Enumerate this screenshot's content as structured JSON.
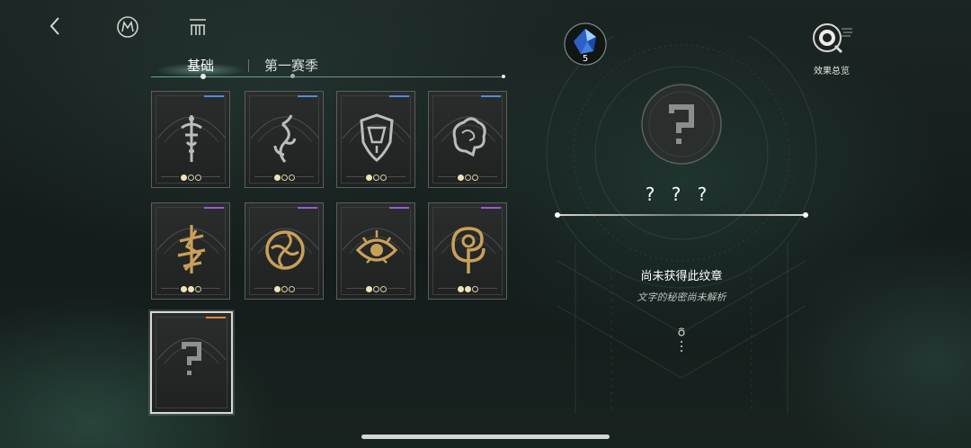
{
  "tabs": [
    {
      "label": "基础",
      "active": true
    },
    {
      "label": "第一赛季",
      "active": false
    }
  ],
  "currency": {
    "icon": "blue-crystal-icon",
    "count": "5"
  },
  "effects_overview": {
    "label": "效果总览",
    "icon": "magnifier-icon"
  },
  "detail": {
    "title": "? ? ?",
    "status": "尚未获得此纹章",
    "description": "文字的秘密尚未解析",
    "icon": "question-mark-icon"
  },
  "colors": {
    "bar_blue": "#4a8fe0",
    "bar_purple": "#9a5ad8",
    "bar_orange": "#e08a3a",
    "emblem_silver": "#b9bdbb",
    "emblem_gold": "#c9a05a"
  },
  "badges": [
    {
      "name": "sword-emblem",
      "tier": "blue",
      "style": "silver",
      "pips": 1
    },
    {
      "name": "vine-emblem",
      "tier": "blue",
      "style": "silver",
      "pips": 1
    },
    {
      "name": "shield-emblem",
      "tier": "blue",
      "style": "silver",
      "pips": 1
    },
    {
      "name": "brain-emblem",
      "tier": "blue",
      "style": "silver",
      "pips": 1
    },
    {
      "name": "thorn-emblem",
      "tier": "purple",
      "style": "gold",
      "pips": 2
    },
    {
      "name": "vortex-emblem",
      "tier": "purple",
      "style": "gold",
      "pips": 1
    },
    {
      "name": "eye-emblem",
      "tier": "purple",
      "style": "gold",
      "pips": 1
    },
    {
      "name": "spiral-emblem",
      "tier": "purple",
      "style": "gold",
      "pips": 2
    },
    {
      "name": "unknown-emblem",
      "tier": "orange",
      "style": "locked",
      "pips": 0,
      "selected": true
    }
  ]
}
